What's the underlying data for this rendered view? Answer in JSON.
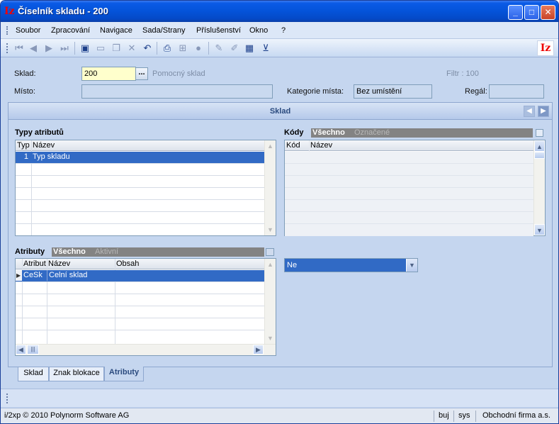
{
  "window": {
    "title": "Číselník skladu - 200",
    "min": "_",
    "max": "□",
    "close": "✕"
  },
  "menu": {
    "items": [
      "Soubor",
      "Zpracování",
      "Navigace",
      "Sada/Strany",
      "Příslušenství",
      "Okno",
      "?"
    ]
  },
  "form": {
    "sklad_label": "Sklad:",
    "sklad_value": "200",
    "sklad_btn": "...",
    "sklad_desc": "Pomocný sklad",
    "filtr_text": "Filtr : 100",
    "misto_label": "Místo:",
    "misto_value": "",
    "kategorie_label": "Kategorie místa:",
    "kategorie_value": "Bez umístění",
    "regal_label": "Regál:",
    "regal_value": ""
  },
  "panel": {
    "title": "Sklad"
  },
  "typy": {
    "title": "Typy atributů",
    "col_typ": "Typ",
    "col_nazev": "Název",
    "rows": [
      {
        "typ": "1",
        "nazev": "Typ skladu"
      }
    ]
  },
  "kody": {
    "title": "Kódy",
    "filter_all": "Všechno",
    "filter_marked": "Označené",
    "col_kod": "Kód",
    "col_nazev": "Název"
  },
  "atributy": {
    "title": "Atributy",
    "filter_all": "Všechno",
    "filter_active": "Aktivní",
    "col_atribut": "Atribut",
    "col_nazev": "Název",
    "col_obsah": "Obsah",
    "rows": [
      {
        "atribut": "CeSk",
        "nazev": "Celní sklad",
        "obsah": ""
      }
    ]
  },
  "combo": {
    "value": "Ne"
  },
  "tabs": [
    "Sklad",
    "Znak blokace",
    "Atributy"
  ],
  "status": {
    "app": "i/2xp © 2010 Polynorm Software AG",
    "user": "buj",
    "db": "sys",
    "company": "Obchodní firma a.s."
  }
}
